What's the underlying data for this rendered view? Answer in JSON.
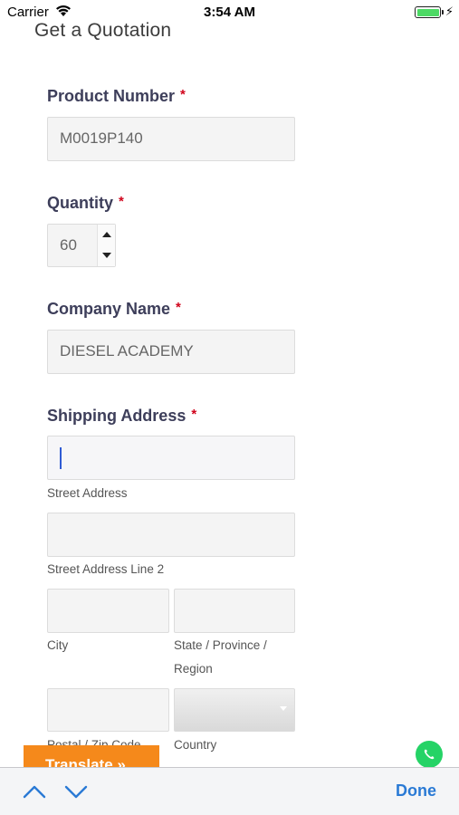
{
  "status_bar": {
    "carrier": "Carrier",
    "time": "3:54 AM"
  },
  "page": {
    "title": "Get a Quotation"
  },
  "form": {
    "required_mark": "*",
    "product_number": {
      "label": "Product Number",
      "value": "M0019P140"
    },
    "quantity": {
      "label": "Quantity",
      "value": "60"
    },
    "company_name": {
      "label": "Company Name",
      "value": "DIESEL ACADEMY"
    },
    "shipping_address": {
      "label": "Shipping Address",
      "street_label": "Street Address",
      "street2_label": "Street Address Line 2",
      "city_label": "City",
      "state_label_1": "State / Province /",
      "state_label_2": "Region",
      "postal_label": "Postal / Zip Code",
      "country_label": "Country"
    }
  },
  "translate": {
    "label": "Translate »"
  },
  "accessory_bar": {
    "done_label": "Done"
  },
  "colors": {
    "accent": "#2a7ad5",
    "required": "#d0021b",
    "translate_bg": "#f5891b",
    "whatsapp": "#25d366"
  }
}
